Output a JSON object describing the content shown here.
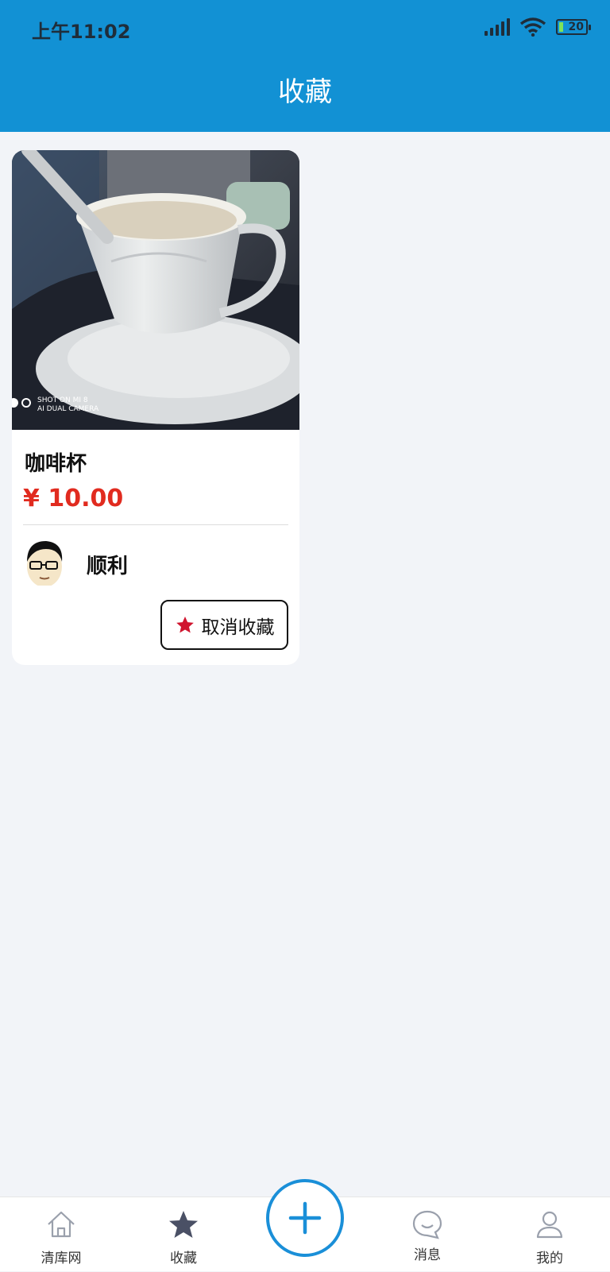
{
  "status_bar": {
    "time": "上午11:02",
    "battery": "20"
  },
  "header": {
    "title": "收藏"
  },
  "favorites": [
    {
      "name": "咖啡杯",
      "price": "¥ 10.00",
      "seller": "顺利",
      "photo_watermark_line1": "SHOT ON MI 8",
      "photo_watermark_line2": "AI DUAL CAMERA",
      "unfavorite_label": "取消收藏"
    }
  ],
  "tabbar": {
    "tabs": [
      {
        "label": "清库网",
        "icon": "home-icon"
      },
      {
        "label": "收藏",
        "icon": "star-icon"
      },
      {
        "label": "消息",
        "icon": "chat-bubble-icon"
      },
      {
        "label": "我的",
        "icon": "person-icon"
      }
    ],
    "fab_icon": "plus-icon"
  },
  "colors": {
    "header_bg": "#1291d4",
    "price": "#e12b1f",
    "star": "#d0152f",
    "fab_border": "#1a8fd8",
    "active_tab_icon": "#4a5065"
  }
}
